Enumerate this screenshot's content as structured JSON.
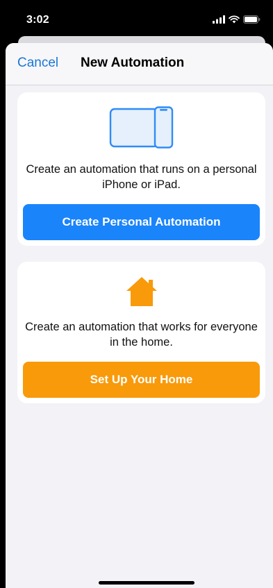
{
  "status_bar": {
    "time": "3:02",
    "icons": [
      "signal-icon",
      "wifi-icon",
      "battery-icon"
    ]
  },
  "nav": {
    "cancel_label": "Cancel",
    "title": "New Automation"
  },
  "cards": {
    "personal": {
      "icon": "ipad-iphone-icon",
      "description": "Create an automation that runs on a personal iPhone or iPad.",
      "button_label": "Create Personal Automation"
    },
    "home": {
      "icon": "home-icon",
      "description": "Create an automation that works for everyone in the home.",
      "button_label": "Set Up Your Home"
    }
  },
  "colors": {
    "accent_blue": "#1a84fb",
    "link_blue": "#1a76d6",
    "home_orange": "#f89a0a",
    "sheet_background": "#f2f2f7"
  }
}
